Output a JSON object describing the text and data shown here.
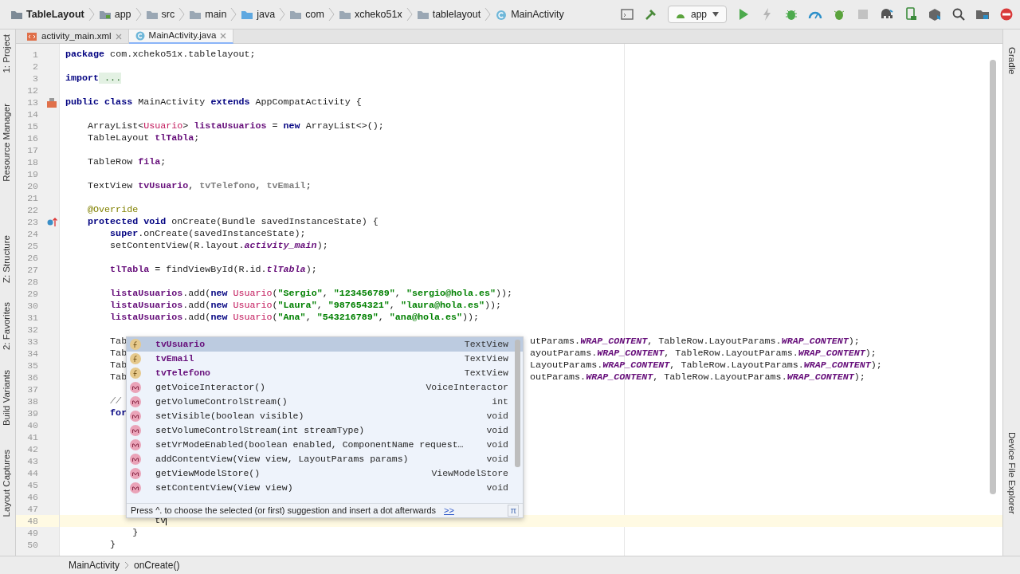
{
  "breadcrumb": [
    {
      "label": "TableLayout",
      "kind": "project"
    },
    {
      "label": "app",
      "kind": "module"
    },
    {
      "label": "src",
      "kind": "folder"
    },
    {
      "label": "main",
      "kind": "folder"
    },
    {
      "label": "java",
      "kind": "source"
    },
    {
      "label": "com",
      "kind": "folder"
    },
    {
      "label": "xcheko51x",
      "kind": "folder"
    },
    {
      "label": "tablelayout",
      "kind": "folder"
    },
    {
      "label": "MainActivity",
      "kind": "class"
    }
  ],
  "run_config": "app",
  "left_tools": [
    "1: Project",
    "Resource Manager",
    "Z: Structure",
    "2: Favorites",
    "Build Variants",
    "Layout Captures"
  ],
  "right_tools": [
    "Gradle",
    "Device File Explorer"
  ],
  "tabs": [
    {
      "label": "activity_main.xml",
      "kind": "xml",
      "selected": false
    },
    {
      "label": "MainActivity.java",
      "kind": "class",
      "selected": true
    }
  ],
  "lines": [
    {
      "n": "1",
      "current": false,
      "code": [
        {
          "kind": "kw",
          "text": "package"
        },
        {
          "kind": "t",
          "text": " com.xcheko51x.tablelayout;"
        }
      ]
    },
    {
      "n": "2",
      "current": false
    },
    {
      "n": "3",
      "current": false,
      "code": [
        {
          "kind": "kw",
          "text": "import"
        },
        {
          "kind": "fold",
          "text": " ..."
        }
      ]
    },
    {
      "n": "12",
      "current": false
    },
    {
      "n": "13",
      "current": false,
      "gutter": {
        "kind": "layout"
      },
      "code": [
        {
          "kind": "kw",
          "text": "public class"
        },
        {
          "kind": "t",
          "text": " MainActivity "
        },
        {
          "kind": "kw",
          "text": "extends"
        },
        {
          "kind": "t",
          "text": " AppCompatActivity {"
        }
      ]
    },
    {
      "n": "14",
      "current": false
    },
    {
      "n": "15",
      "current": false,
      "code": [
        {
          "kind": "t",
          "text": "    ArrayList<"
        },
        {
          "kind": "cls",
          "text": "Usuario"
        },
        {
          "kind": "t",
          "text": "> "
        },
        {
          "kind": "field",
          "text": "listaUsuarios"
        },
        {
          "kind": "t",
          "text": " = "
        },
        {
          "kind": "kw",
          "text": "new"
        },
        {
          "kind": "t",
          "text": " ArrayList<>();"
        }
      ]
    },
    {
      "n": "16",
      "current": false,
      "code": [
        {
          "kind": "t",
          "text": "    TableLayout "
        },
        {
          "kind": "field",
          "text": "tlTabla"
        },
        {
          "kind": "t",
          "text": ";"
        }
      ]
    },
    {
      "n": "17",
      "current": false
    },
    {
      "n": "18",
      "current": false,
      "code": [
        {
          "kind": "t",
          "text": "    TableRow "
        },
        {
          "kind": "field",
          "text": "fila"
        },
        {
          "kind": "t",
          "text": ";"
        }
      ]
    },
    {
      "n": "19",
      "current": false
    },
    {
      "n": "20",
      "current": false,
      "code": [
        {
          "kind": "t",
          "text": "    TextView "
        },
        {
          "kind": "field",
          "text": "tvUsuario"
        },
        {
          "kind": "t",
          "text": ", "
        },
        {
          "kind": "unused",
          "text": "tvTelefono"
        },
        {
          "kind": "t",
          "text": ", "
        },
        {
          "kind": "unused",
          "text": "tvEmail"
        },
        {
          "kind": "t",
          "text": ";"
        }
      ]
    },
    {
      "n": "21",
      "current": false
    },
    {
      "n": "22",
      "current": false,
      "code": [
        {
          "kind": "annot",
          "text": "    @Override"
        }
      ]
    },
    {
      "n": "23",
      "current": false,
      "gutter": {
        "kind": "override"
      },
      "code": [
        {
          "kind": "kw",
          "text": "    protected void"
        },
        {
          "kind": "t",
          "text": " onCreate(Bundle savedInstanceState) {"
        }
      ]
    },
    {
      "n": "24",
      "current": false,
      "code": [
        {
          "kind": "kw",
          "text": "        super"
        },
        {
          "kind": "t",
          "text": ".onCreate(savedInstanceState);"
        }
      ]
    },
    {
      "n": "25",
      "current": false,
      "code": [
        {
          "kind": "t",
          "text": "        setContentView(R.layout."
        },
        {
          "kind": "static",
          "text": "activity_main"
        },
        {
          "kind": "t",
          "text": ");"
        }
      ]
    },
    {
      "n": "26",
      "current": false
    },
    {
      "n": "27",
      "current": false,
      "code": [
        {
          "kind": "field",
          "text": "        tlTabla"
        },
        {
          "kind": "t",
          "text": " = findViewById(R.id."
        },
        {
          "kind": "static",
          "text": "tlTabla"
        },
        {
          "kind": "t",
          "text": ");"
        }
      ]
    },
    {
      "n": "28",
      "current": false
    },
    {
      "n": "29",
      "current": false,
      "code": [
        {
          "kind": "field",
          "text": "        listaUsuarios"
        },
        {
          "kind": "t",
          "text": ".add("
        },
        {
          "kind": "kw",
          "text": "new"
        },
        {
          "kind": "cls",
          "text": " Usuario"
        },
        {
          "kind": "t",
          "text": "("
        },
        {
          "kind": "str",
          "text": "\"Sergio\""
        },
        {
          "kind": "t",
          "text": ", "
        },
        {
          "kind": "str",
          "text": "\"123456789\""
        },
        {
          "kind": "t",
          "text": ", "
        },
        {
          "kind": "str",
          "text": "\"sergio@hola.es\""
        },
        {
          "kind": "t",
          "text": "));"
        }
      ]
    },
    {
      "n": "30",
      "current": false,
      "code": [
        {
          "kind": "field",
          "text": "        listaUsuarios"
        },
        {
          "kind": "t",
          "text": ".add("
        },
        {
          "kind": "kw",
          "text": "new"
        },
        {
          "kind": "cls",
          "text": " Usuario"
        },
        {
          "kind": "t",
          "text": "("
        },
        {
          "kind": "str",
          "text": "\"Laura\""
        },
        {
          "kind": "t",
          "text": ", "
        },
        {
          "kind": "str",
          "text": "\"987654321\""
        },
        {
          "kind": "t",
          "text": ", "
        },
        {
          "kind": "str",
          "text": "\"laura@hola.es\""
        },
        {
          "kind": "t",
          "text": "));"
        }
      ]
    },
    {
      "n": "31",
      "current": false,
      "code": [
        {
          "kind": "field",
          "text": "        listaUsuarios"
        },
        {
          "kind": "t",
          "text": ".add("
        },
        {
          "kind": "kw",
          "text": "new"
        },
        {
          "kind": "cls",
          "text": " Usuario"
        },
        {
          "kind": "t",
          "text": "("
        },
        {
          "kind": "str",
          "text": "\"Ana\""
        },
        {
          "kind": "t",
          "text": ", "
        },
        {
          "kind": "str",
          "text": "\"543216789\""
        },
        {
          "kind": "t",
          "text": ", "
        },
        {
          "kind": "str",
          "text": "\"ana@hola.es\""
        },
        {
          "kind": "t",
          "text": "));"
        }
      ]
    },
    {
      "n": "32",
      "current": false
    },
    {
      "n": "33",
      "current": false,
      "code": [
        {
          "kind": "t",
          "text": "        Tab"
        }
      ],
      "code_after": [
        {
          "kind": "t",
          "text": "utParams."
        },
        {
          "kind": "static",
          "text": "WRAP_CONTENT"
        },
        {
          "kind": "t",
          "text": ", TableRow.LayoutParams."
        },
        {
          "kind": "static",
          "text": "WRAP_CONTENT"
        },
        {
          "kind": "t",
          "text": ");"
        }
      ]
    },
    {
      "n": "34",
      "current": false,
      "code": [
        {
          "kind": "t",
          "text": "        Tab"
        }
      ],
      "code_after": [
        {
          "kind": "t",
          "text": "ayoutParams."
        },
        {
          "kind": "static",
          "text": "WRAP_CONTENT"
        },
        {
          "kind": "t",
          "text": ", TableRow.LayoutParams."
        },
        {
          "kind": "static",
          "text": "WRAP_CONTENT"
        },
        {
          "kind": "t",
          "text": ");"
        }
      ]
    },
    {
      "n": "35",
      "current": false,
      "code": [
        {
          "kind": "t",
          "text": "        Tab"
        }
      ],
      "code_after": [
        {
          "kind": "t",
          "text": "LayoutParams."
        },
        {
          "kind": "static",
          "text": "WRAP_CONTENT"
        },
        {
          "kind": "t",
          "text": ", TableRow.LayoutParams."
        },
        {
          "kind": "static",
          "text": "WRAP_CONTENT"
        },
        {
          "kind": "t",
          "text": ");"
        }
      ]
    },
    {
      "n": "36",
      "current": false,
      "code": [
        {
          "kind": "t",
          "text": "        Tab"
        }
      ],
      "code_after": [
        {
          "kind": "t",
          "text": "outParams."
        },
        {
          "kind": "static",
          "text": "WRAP_CONTENT"
        },
        {
          "kind": "t",
          "text": ", TableRow.LayoutParams."
        },
        {
          "kind": "static",
          "text": "WRAP_CONTENT"
        },
        {
          "kind": "t",
          "text": ");"
        }
      ]
    },
    {
      "n": "37",
      "current": false
    },
    {
      "n": "38",
      "current": false,
      "code": [
        {
          "kind": "comment",
          "text": "        //"
        }
      ]
    },
    {
      "n": "39",
      "current": false,
      "code": [
        {
          "kind": "kw",
          "text": "        for"
        }
      ]
    },
    {
      "n": "40",
      "current": false
    },
    {
      "n": "41",
      "current": false
    },
    {
      "n": "42",
      "current": false
    },
    {
      "n": "43",
      "current": false
    },
    {
      "n": "44",
      "current": false
    },
    {
      "n": "45",
      "current": false
    },
    {
      "n": "46",
      "current": false
    },
    {
      "n": "47",
      "current": false
    },
    {
      "n": "48",
      "current": true,
      "code": [
        {
          "kind": "t",
          "text": "                tv"
        }
      ]
    },
    {
      "n": "49",
      "current": false,
      "code": [
        {
          "kind": "t",
          "text": "            }"
        }
      ]
    },
    {
      "n": "50",
      "current": false,
      "code": [
        {
          "kind": "t",
          "text": "        }"
        }
      ]
    }
  ],
  "completion": {
    "items": [
      {
        "kind": "field",
        "name": "tvUsuario",
        "type": "TextView",
        "selected": true
      },
      {
        "kind": "field",
        "name": "tvEmail",
        "type": "TextView",
        "selected": false
      },
      {
        "kind": "field",
        "name": "tvTelefono",
        "type": "TextView",
        "selected": false
      },
      {
        "kind": "method",
        "name": "getVoiceInteractor()",
        "type": "VoiceInteractor",
        "selected": false
      },
      {
        "kind": "method",
        "name": "getVolumeControlStream()",
        "type": "int",
        "selected": false
      },
      {
        "kind": "method",
        "name": "setVisible(boolean visible)",
        "type": "void",
        "selected": false
      },
      {
        "kind": "method",
        "name": "setVolumeControlStream(int streamType)",
        "type": "void",
        "selected": false
      },
      {
        "kind": "method",
        "name": "setVrModeEnabled(boolean enabled, ComponentName request…",
        "type": "void",
        "selected": false
      },
      {
        "kind": "method",
        "name": "addContentView(View view, LayoutParams params)",
        "type": "void",
        "selected": false
      },
      {
        "kind": "method",
        "name": "getViewModelStore()",
        "type": "ViewModelStore",
        "selected": false
      },
      {
        "kind": "method",
        "name": "setContentView(View view)",
        "type": "void",
        "selected": false
      }
    ],
    "hint": "Press ^. to choose the selected (or first) suggestion and insert a dot afterwards",
    "hint_link": ">>",
    "pi": "π"
  },
  "status_breadcrumb": [
    "MainActivity",
    "onCreate()"
  ]
}
